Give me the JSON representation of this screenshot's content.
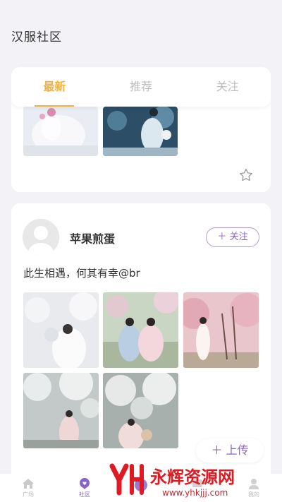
{
  "header": {
    "title": "汉服社区"
  },
  "tabs": [
    {
      "label": "最新",
      "active": true
    },
    {
      "label": "推荐",
      "active": false
    },
    {
      "label": "关注",
      "active": false
    }
  ],
  "post": {
    "username": "苹果煎蛋",
    "follow_label": "关注",
    "text": "此生相遇，何其有幸@br"
  },
  "upload_label": "上传",
  "bottom_nav": [
    {
      "label": "广场",
      "icon": "home-icon"
    },
    {
      "label": "社区",
      "icon": "community-icon"
    },
    {
      "label": "",
      "icon": "create-icon"
    },
    {
      "label": "",
      "icon": "message-icon"
    },
    {
      "label": "我的",
      "icon": "profile-icon"
    }
  ],
  "watermark": {
    "brand": "永辉资源网",
    "url": "www.yhkjjj.com"
  },
  "colors": {
    "accent_tab": "#f4b13e",
    "accent_purple": "#8a63c6",
    "background": "#f3f2f6"
  }
}
